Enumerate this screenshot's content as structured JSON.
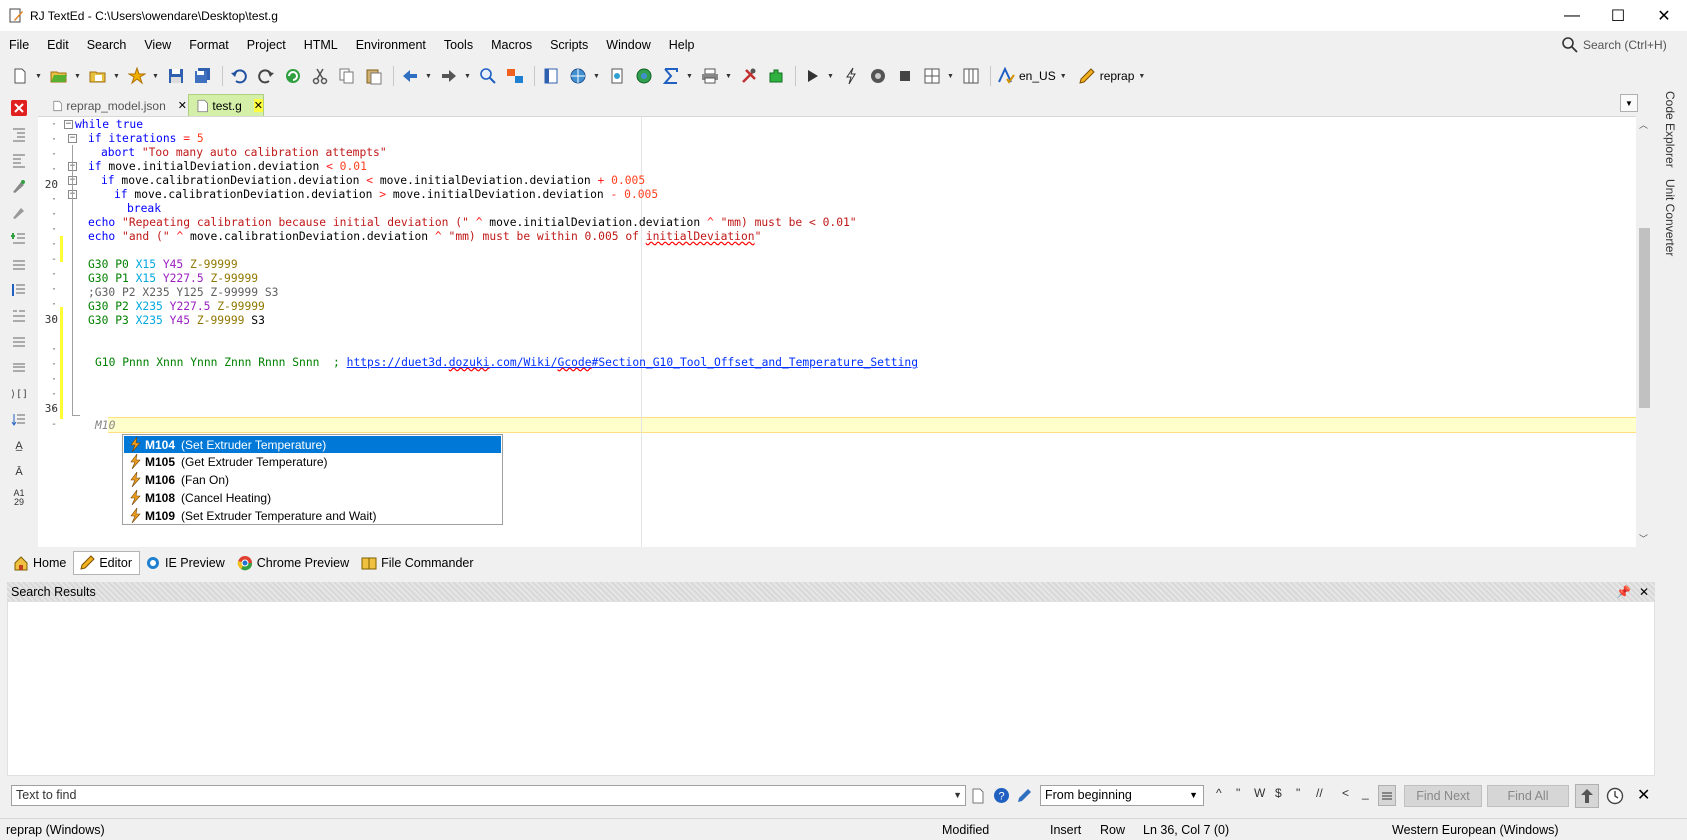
{
  "window": {
    "title": "RJ TextEd - C:\\Users\\owendare\\Desktop\\test.g",
    "min": "—",
    "max": "☐",
    "close": "✕"
  },
  "menu": {
    "items": [
      "File",
      "Edit",
      "Search",
      "View",
      "Format",
      "Project",
      "HTML",
      "Environment",
      "Tools",
      "Macros",
      "Scripts",
      "Window",
      "Help"
    ],
    "search_placeholder": "Search (Ctrl+H)"
  },
  "toolbar": {
    "language": "en_US",
    "syntax": "reprap"
  },
  "tabs": [
    {
      "label": "reprap_model.json",
      "close": "✕"
    },
    {
      "label": "test.g",
      "close": "✕"
    }
  ],
  "editor": {
    "line_numbers": {
      "l20": "20",
      "l30": "30",
      "l36": "36"
    },
    "lines": {
      "l1": {
        "kw": "while",
        "rest": " true"
      },
      "l2": {
        "kw": "if",
        "mid": " iterations ",
        "op": "=",
        "num": " 5"
      },
      "l3": {
        "kw": "abort",
        "str": " \"Too many auto calibration attempts\""
      },
      "l4": {
        "kw": "if",
        "mid": " move.initialDeviation.deviation ",
        "op": "<",
        "num": " 0.01"
      },
      "l5": {
        "kw": "if",
        "mid": " move.calibrationDeviation.deviation ",
        "op": "<",
        "mid2": " move.initialDeviation.deviation ",
        "op2": "+",
        "num": " 0.005"
      },
      "l6": {
        "kw": "if",
        "mid": " move.calibrationDeviation.deviation ",
        "op": ">",
        "mid2": " move.initialDeviation.deviation ",
        "op2": "-",
        "num": " 0.005"
      },
      "l7": {
        "kw": "break"
      },
      "l8": {
        "kw": "echo",
        "str": " \"Repeating calibration because initial deviation (\"",
        "op": " ^",
        "mid": " move.initialDeviation.deviation ",
        "op2": "^",
        "str2": " \"mm) must be < 0.01\""
      },
      "l9": {
        "kw": "echo",
        "str": " \"and (\"",
        "op": " ^",
        "mid": " move.calibrationDeviation.deviation ",
        "op2": "^",
        "str2": " \"mm) must be within 0.005 of ",
        "squig": "initialDeviation",
        "str3": "\""
      },
      "g1": {
        "g": "G30",
        "p": " P0 ",
        "x": "X15",
        "y": " Y45",
        "z": " Z-99999"
      },
      "g2": {
        "g": "G30",
        "p": " P1 ",
        "x": "X15",
        "y": " Y227.5",
        "z": " Z-99999"
      },
      "g3": {
        "cm": ";G30 P2 X235 Y125 Z-99999 S3"
      },
      "g4": {
        "g": "G30",
        "p": " P2 ",
        "x": "X235",
        "y": " Y227.5",
        "z": " Z-99999"
      },
      "g5": {
        "g": "G30",
        "p": " P3 ",
        "x": "X235",
        "y": " Y45",
        "z": " Z-99999",
        "s": " S3"
      },
      "g10": {
        "g": "G10",
        "params": " Pnnn Xnnn Ynnn Znnn Rnnn Snnn  ; ",
        "link_a": "https://duet3d.",
        "link_b": "dozuki",
        "link_c": ".com/Wiki/",
        "link_d": "Gcode",
        "link_e": "#Section_G10_Tool_Offset_and_Temperature_Setting"
      },
      "cur": {
        "text": "M10"
      }
    }
  },
  "autocomplete": [
    {
      "code": "M104",
      "desc": "(Set Extruder Temperature)"
    },
    {
      "code": "M105",
      "desc": "(Get Extruder Temperature)"
    },
    {
      "code": "M106",
      "desc": "(Fan On)"
    },
    {
      "code": "M108",
      "desc": "(Cancel Heating)"
    },
    {
      "code": "M109",
      "desc": "(Set Extruder Temperature and Wait)"
    }
  ],
  "sidebar_right": {
    "code_explorer": "Code Explorer",
    "unit_converter": "Unit Converter"
  },
  "bottom_tabs": [
    "Home",
    "Editor",
    "IE Preview",
    "Chrome Preview",
    "File Commander"
  ],
  "search_results": {
    "title": "Search Results",
    "pin": "📌",
    "close": "✕"
  },
  "findbar": {
    "placeholder": "Text to find",
    "from": "From beginning",
    "options": [
      "^",
      "\"",
      "W",
      "$",
      "\"",
      "//",
      "<",
      "_"
    ],
    "find_next": "Find Next",
    "find_all": "Find All",
    "close": "✕"
  },
  "status": {
    "syntax": "reprap (Windows)",
    "modified": "Modified",
    "insert": "Insert",
    "row": "Row",
    "position": "Ln 36, Col 7 (0)",
    "encoding": "Western European (Windows)"
  },
  "colors": {
    "accent": "#0078d7",
    "current_line": "#ffffcc",
    "change_mark": "#ffff33"
  }
}
